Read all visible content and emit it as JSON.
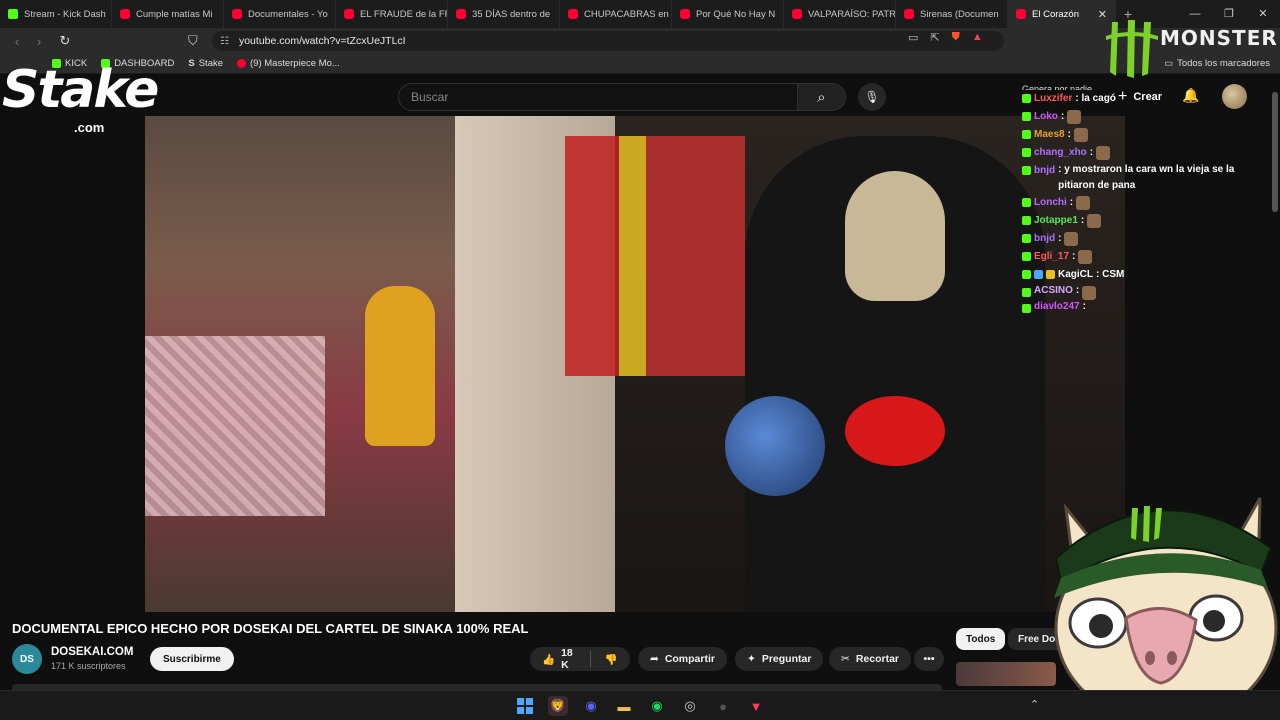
{
  "browser": {
    "tabs": [
      {
        "title": "Stream - Kick Dash",
        "favicon": "kick-icon"
      },
      {
        "title": "Cumple matías Mi",
        "favicon": "youtube-icon"
      },
      {
        "title": "Documentales - Yo",
        "favicon": "youtube-icon"
      },
      {
        "title": "EL FRAUDE de la FF",
        "favicon": "youtube-icon"
      },
      {
        "title": "35 DÍAS dentro de",
        "favicon": "youtube-icon"
      },
      {
        "title": "CHUPACABRAS en",
        "favicon": "youtube-icon"
      },
      {
        "title": "Por Qué No Hay N",
        "favicon": "youtube-icon"
      },
      {
        "title": "VALPARAÍSO: PATR",
        "favicon": "youtube-icon"
      },
      {
        "title": "Sirenas (Documen",
        "favicon": "youtube-icon"
      },
      {
        "title": "El Corazón",
        "favicon": "youtube-icon",
        "active": true
      }
    ],
    "url": "youtube.com/watch?v=tZcxUeJTLcI",
    "bookmarks": [
      {
        "label": "KICK",
        "favicon": "kick-icon"
      },
      {
        "label": "DASHBOARD",
        "favicon": "kick-icon"
      },
      {
        "label": "Stake",
        "favicon": "stake-icon"
      },
      {
        "label": "(9) Masterpiece Mo...",
        "favicon": "youtube-icon"
      }
    ],
    "all_bookmarks": "Todos los marcadores"
  },
  "youtube": {
    "search_placeholder": "Buscar",
    "create_label": "Crear",
    "video": {
      "title": "DOCUMENTAL EPICO HECHO POR DOSEKAI DEL CARTEL DE SINAKA 100% REAL",
      "channel": "DOSEKAI.COM",
      "subscribers": "171 K suscriptores",
      "subscribe_label": "Suscribirme",
      "likes": "18 K",
      "share_label": "Compartir",
      "ask_label": "Preguntar",
      "clip_label": "Recortar"
    },
    "chips": [
      "Todos",
      "Free Doc"
    ]
  },
  "overlay": {
    "stake_logo": "Stake",
    "stake_com": ".com",
    "monster_logo": "MONSTER",
    "chat": [
      {
        "user": "Luxzifer",
        "msg": ": la cagó",
        "color": "#ff5a5a"
      },
      {
        "user": "Loko",
        "msg": ":",
        "color": "#d058ff",
        "emote": true
      },
      {
        "user": "Maes8",
        "msg": ":",
        "color": "#e8a030",
        "emote": true
      },
      {
        "user": "chang_xho",
        "msg": ":",
        "color": "#b070ff",
        "emote": true
      },
      {
        "user": "bnjd",
        "msg": ": y mostraron la cara wn la vieja se la pitiaron de pana",
        "color": "#b070ff"
      },
      {
        "user": "Lonchi",
        "msg": ":",
        "color": "#b070ff",
        "emote": true
      },
      {
        "user": "Jotappe1",
        "msg": ":",
        "color": "#58e858",
        "emote": true
      },
      {
        "user": "bnjd",
        "msg": ":",
        "color": "#b070ff",
        "emote": true
      },
      {
        "user": "Egli_17",
        "msg": ":",
        "color": "#ff5a5a",
        "emote": true
      },
      {
        "user": "KagiCL",
        "msg": ": CSM",
        "color": "#ffffff"
      },
      {
        "user": "ACSINO",
        "msg": ":",
        "color": "#d8a8ff",
        "emote": true
      },
      {
        "user": "diavlo247",
        "msg": ":",
        "color": "#d058ff",
        "emote": true
      }
    ],
    "chat_header": "Genera por nadie"
  },
  "colors": {
    "kick_green": "#53fc18",
    "youtube_red": "#ff0033",
    "yt_bg": "#0f0f0f",
    "monster_green": "#7cd12a"
  }
}
